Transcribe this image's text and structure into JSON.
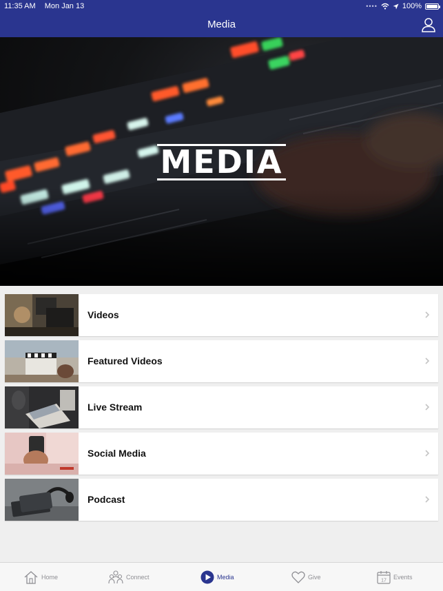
{
  "status_bar": {
    "time": "11:35 AM",
    "date": "Mon Jan 13",
    "battery": "100%"
  },
  "nav": {
    "title": "Media",
    "profile_icon": "person-icon"
  },
  "hero": {
    "title": "MEDIA"
  },
  "list": [
    {
      "label": "Videos",
      "thumb": "camera-crew-photo"
    },
    {
      "label": "Featured Videos",
      "thumb": "clapperboard-photo"
    },
    {
      "label": "Live Stream",
      "thumb": "laptop-photo"
    },
    {
      "label": "Social Media",
      "thumb": "phone-in-hand-photo"
    },
    {
      "label": "Podcast",
      "thumb": "headphones-phone-photo"
    }
  ],
  "tabbar": [
    {
      "label": "Home",
      "icon": "home-icon"
    },
    {
      "label": "Connect",
      "icon": "people-icon"
    },
    {
      "label": "Media",
      "icon": "play-icon",
      "active": true
    },
    {
      "label": "Give",
      "icon": "heart-icon"
    },
    {
      "label": "Events",
      "icon": "calendar-icon"
    }
  ],
  "colors": {
    "brand": "#2a358f",
    "background": "#efefef",
    "tab_inactive": "#8e8e93"
  }
}
